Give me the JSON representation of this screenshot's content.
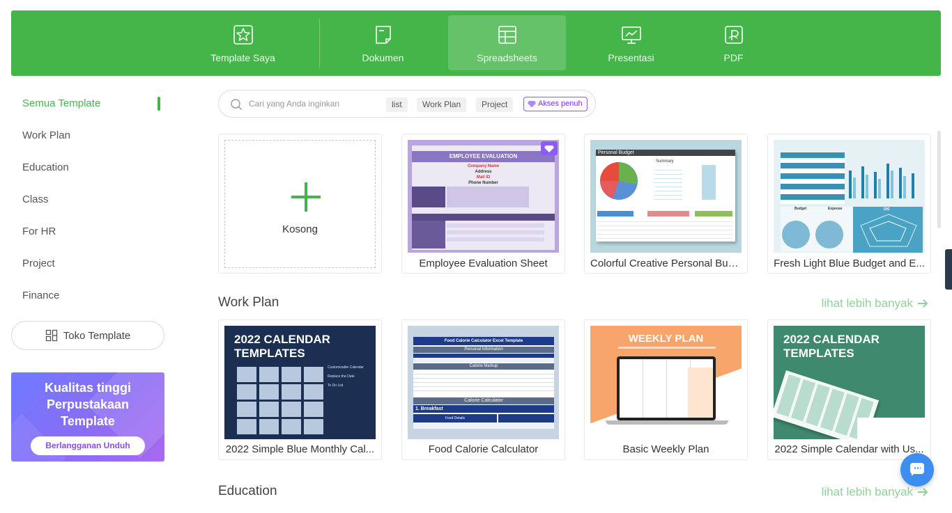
{
  "topnav": {
    "tabs": [
      {
        "label": "Template Saya",
        "icon": "star-icon"
      },
      {
        "label": "Dokumen",
        "icon": "document-icon"
      },
      {
        "label": "Spreadsheets",
        "icon": "spreadsheet-icon",
        "active": true
      },
      {
        "label": "Presentasi",
        "icon": "presentation-icon"
      },
      {
        "label": "PDF",
        "icon": "pdf-icon"
      }
    ]
  },
  "sidebar": {
    "items": [
      {
        "label": "Semua Template",
        "active": true
      },
      {
        "label": "Work Plan"
      },
      {
        "label": "Education"
      },
      {
        "label": "Class"
      },
      {
        "label": "For HR"
      },
      {
        "label": "Project"
      },
      {
        "label": "Finance"
      }
    ],
    "store_label": "Toko Template",
    "promo": {
      "title_line1": "Kualitas tinggi",
      "title_line2": "Perpustakaan",
      "title_line3": "Template",
      "button": "Berlangganan Unduh"
    }
  },
  "search": {
    "placeholder": "Cari yang Anda inginkan",
    "chips": [
      "list",
      "Work Plan",
      "Project"
    ],
    "vip_label": "Akses penuh"
  },
  "featured": {
    "blank_label": "Kosong",
    "cards": [
      {
        "title": "Employee Evaluation Sheet",
        "premium": true,
        "thumb": {
          "header": "EMPLOYEE EVALUATION",
          "line1": "Company Name",
          "line2": "Address",
          "line3": "Mail ID",
          "line4": "Phone Number"
        }
      },
      {
        "title": "Colorful Creative Personal Bud...",
        "thumb": {
          "header": "Personal Budget",
          "summary": "Summary"
        }
      },
      {
        "title": "Fresh Light Blue Budget and E...",
        "thumb": {
          "label1": "Budget",
          "label2": "Expense",
          "label3": "DIS"
        }
      }
    ]
  },
  "sections": [
    {
      "title": "Work Plan",
      "more": "lihat lebih banyak",
      "cards": [
        {
          "title": "2022 Simple Blue Monthly Cal...",
          "thumb": {
            "line1": "2022 CALENDAR",
            "line2": "TEMPLATES",
            "bullet1": "Customizable Calendar",
            "bullet2": "Replace the Date",
            "bullet3": "To Do List"
          }
        },
        {
          "title": "Food Calorie Calculator",
          "thumb": {
            "header": "Food Calorie Calculator Excel Template",
            "sub1": "Personal Information",
            "sub2": "Calorie Markup",
            "sub3": "Calorie Calculator",
            "sub4": "1. Breakfast",
            "sub5": "Food Details"
          }
        },
        {
          "title": "Basic Weekly Plan",
          "thumb": {
            "header": "WEEKLY PLAN"
          }
        },
        {
          "title": "2022 Simple Calendar with Us...",
          "thumb": {
            "line1": "2022 CALENDAR",
            "line2": "TEMPLATES"
          }
        }
      ]
    },
    {
      "title": "Education",
      "more": "lihat lebih banyak"
    }
  ],
  "colors": {
    "brand_green": "#44b549",
    "more_link": "#8fd197",
    "premium_purple": "#8b5cf6",
    "chat_blue": "#3d8ef0"
  }
}
